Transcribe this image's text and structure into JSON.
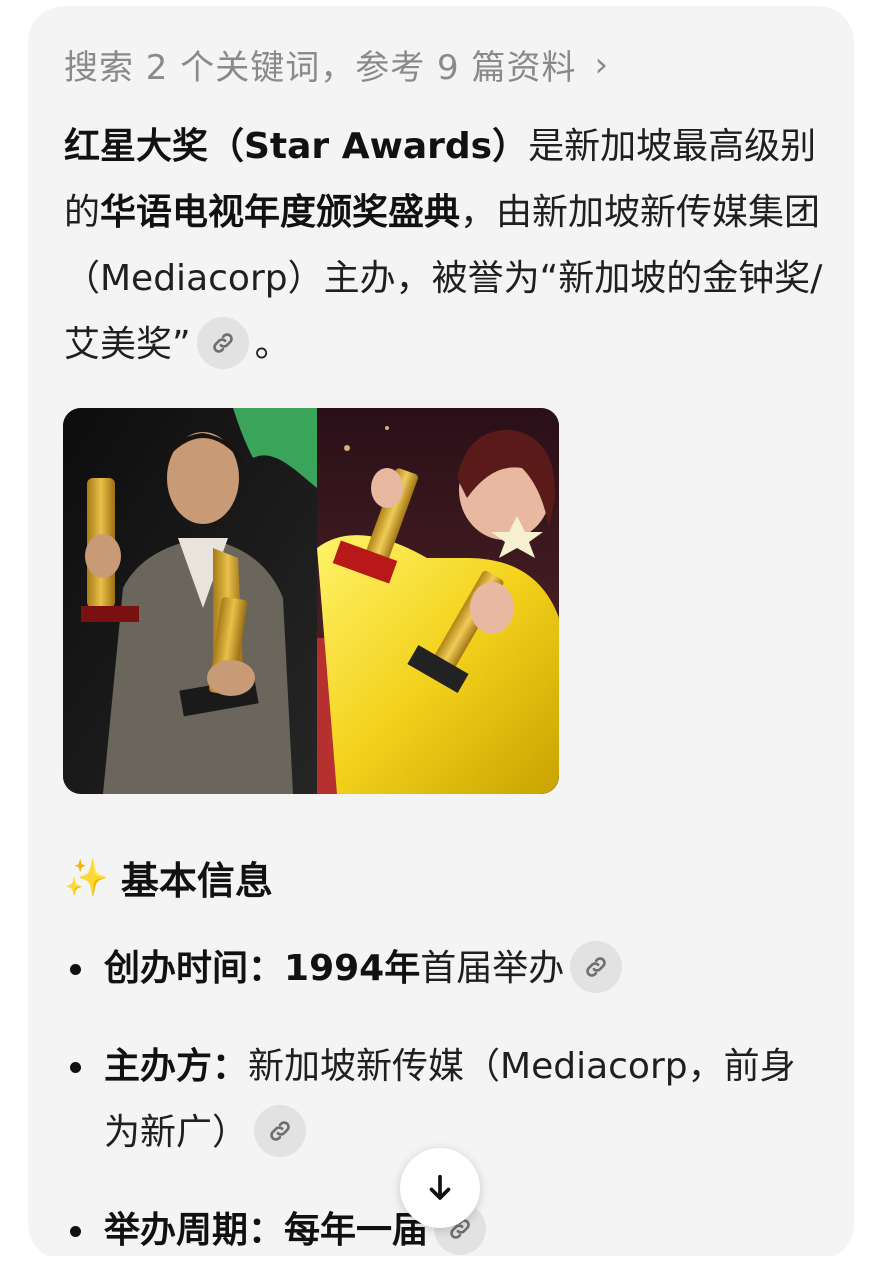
{
  "search": {
    "summary": "搜索 2 个关键词，参考 9 篇资料",
    "chevron": "›"
  },
  "intro": {
    "bold1": "红星大奖（Star Awards）",
    "text1": "是新加坡最高级别的",
    "bold2": "华语电视年度颁奖盛典",
    "text2": "，由新加坡新传媒集团（Mediacorp）主办，被誉为“新加坡的金钟奖/艾美奖”",
    "end": "。"
  },
  "section": {
    "emoji": "✨",
    "title": "基本信息"
  },
  "bullets": [
    {
      "label": "创办时间：",
      "value_bold": "1994年",
      "value": "首届举办"
    },
    {
      "label": "主办方：",
      "value_bold": "",
      "value": "新加坡新传媒（Mediacorp，前身为新广）"
    },
    {
      "label": "举办周期：",
      "value_bold": "每年一届",
      "value": ""
    }
  ],
  "icons": {
    "link": "link-icon",
    "scroll_down": "arrow-down-icon",
    "sparkle": "sparkle-icon"
  },
  "colors": {
    "card_bg": "#f4f4f4",
    "muted_text": "#8a8a8a",
    "chip_bg": "#e2e2e2",
    "jacket_yellow": "#f3d21c"
  }
}
